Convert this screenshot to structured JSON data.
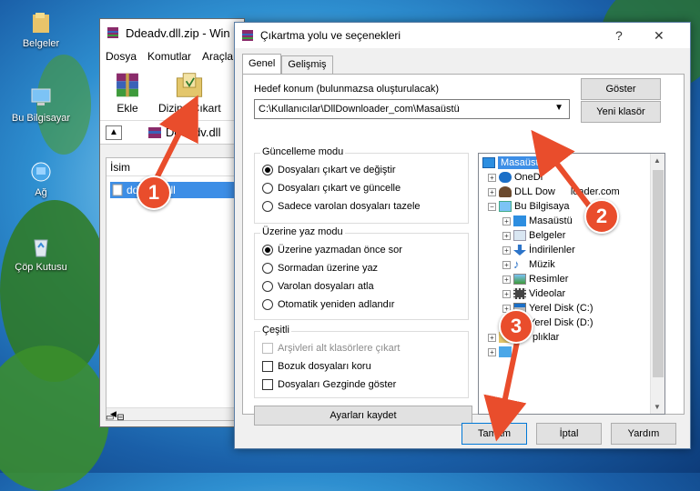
{
  "desktop": {
    "icons": [
      {
        "label": "Belgeler",
        "icon": "folder-icon"
      },
      {
        "label": "Bu Bilgisayar",
        "icon": "computer-icon"
      },
      {
        "label": "Ağ",
        "icon": "network-icon"
      },
      {
        "label": "Çöp Kutusu",
        "icon": "recycle-bin-icon"
      }
    ]
  },
  "winrar": {
    "title": "Ddeadv.dll.zip - Win",
    "menu": [
      "Dosya",
      "Komutlar",
      "Araçla"
    ],
    "toolbar": {
      "add": "Ekle",
      "extract": "Dizine Çıkart"
    },
    "address": "Ddeadv.dll",
    "column_name": "İsim",
    "file": "ddeadv.dll"
  },
  "dialog": {
    "title": "Çıkartma yolu ve seçenekleri",
    "help_glyph": "?",
    "close_glyph": "✕",
    "tabs": [
      "Genel",
      "Gelişmiş"
    ],
    "dest_label": "Hedef konum (bulunmazsa oluşturulacak)",
    "dest_value": "C:\\Kullanıcılar\\DllDownloader_com\\Masaüstü",
    "show_button": "Göster",
    "new_folder_button": "Yeni klasör",
    "update_mode": {
      "title": "Güncelleme modu",
      "options": [
        "Dosyaları çıkart ve değiştir",
        "Dosyaları çıkart ve güncelle",
        "Sadece varolan dosyaları tazele"
      ],
      "selected": 0
    },
    "overwrite_mode": {
      "title": "Üzerine yaz modu",
      "options": [
        "Üzerine yazmadan önce sor",
        "Sormadan üzerine yaz",
        "Varolan dosyaları atla",
        "Otomatik yeniden adlandır"
      ],
      "selected": 0
    },
    "misc": {
      "title": "Çeşitli",
      "options": [
        "Arşivleri alt klasörlere çıkart",
        "Bozuk dosyaları koru",
        "Dosyaları Gezginde göster"
      ]
    },
    "save_settings": "Ayarları kaydet",
    "tree": {
      "root": "Masaüstü",
      "top": [
        "OneDr",
        "DLL Dow",
        "Bu Bilgisaya"
      ],
      "top_tail": [
        "",
        "loader.com",
        ""
      ],
      "children": [
        "Masaüstü",
        "Belgeler",
        "İndirilenler",
        "Müzik",
        "Resimler",
        "Videolar",
        "Yerel Disk (C:)",
        "Yerel Disk (D:)"
      ],
      "after": [
        "plıklar",
        ""
      ]
    },
    "buttons": {
      "ok": "Tamam",
      "cancel": "İptal",
      "help": "Yardım"
    }
  },
  "annotations": [
    "1",
    "2",
    "3"
  ],
  "colors": {
    "annotation": "#e94d2c",
    "selection": "#3d8ee6",
    "arrow": "#e94d2c"
  }
}
